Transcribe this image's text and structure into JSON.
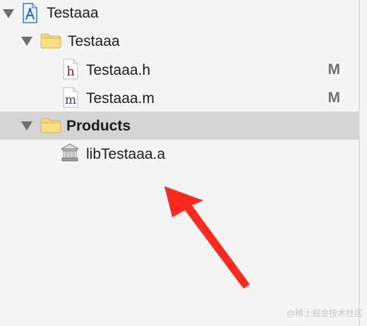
{
  "tree": {
    "project": {
      "label": "Testaaa",
      "icon": "xcode-project-icon"
    },
    "group": {
      "label": "Testaaa",
      "icon": "folder-icon"
    },
    "files": [
      {
        "label": "Testaaa.h",
        "icon_glyph": "h",
        "icon_color": "#8a1d28",
        "status": "M"
      },
      {
        "label": "Testaaa.m",
        "icon_glyph": "m",
        "icon_color": "#4d3a78",
        "status": "M"
      }
    ],
    "products": {
      "label": "Products",
      "icon": "folder-icon"
    },
    "library": {
      "label": "libTestaaa.a",
      "icon": "static-library-icon"
    }
  },
  "annotation": {
    "arrow_color": "#ff2a1f",
    "icon": "red-arrow-icon"
  },
  "watermark": "@稀土掘金技术社区"
}
